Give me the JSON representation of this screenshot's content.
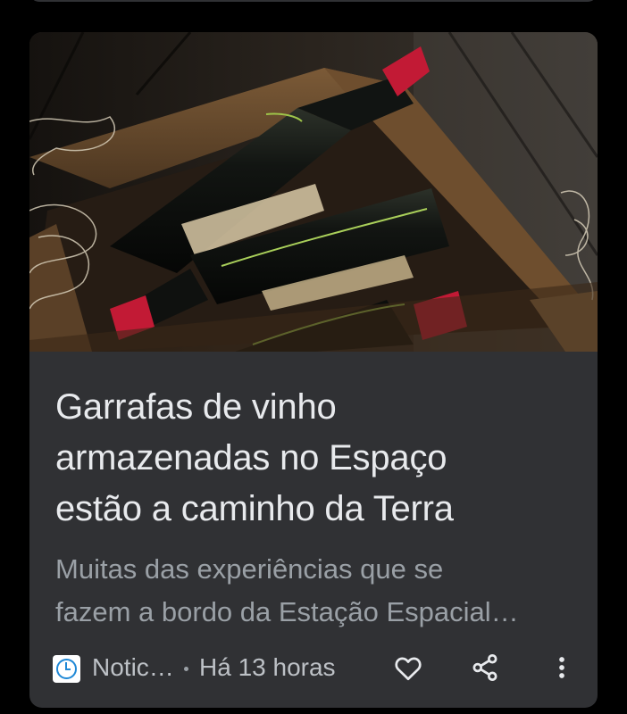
{
  "article": {
    "title_lines": [
      "Garrafas de vinho",
      "armazenadas no Espaço",
      "estão a caminho da Terra"
    ],
    "snippet_lines": [
      "Muitas das experiências que se",
      "fazem a bordo da Estação Espacial…"
    ],
    "image_alt": "Garrafas de vinho numa caixa de madeira"
  },
  "footer": {
    "source": "Notic…",
    "separator": "•",
    "time": "Há 13 horas"
  },
  "icons": {
    "source": "clock-logo-icon",
    "like": "heart-icon",
    "share": "share-icon",
    "more": "more-vert-icon"
  },
  "colors": {
    "background": "#000000",
    "card": "#303134",
    "title": "#e8eaed",
    "snippet": "#9aa0a6",
    "bottle_cap": "#c21a35"
  }
}
